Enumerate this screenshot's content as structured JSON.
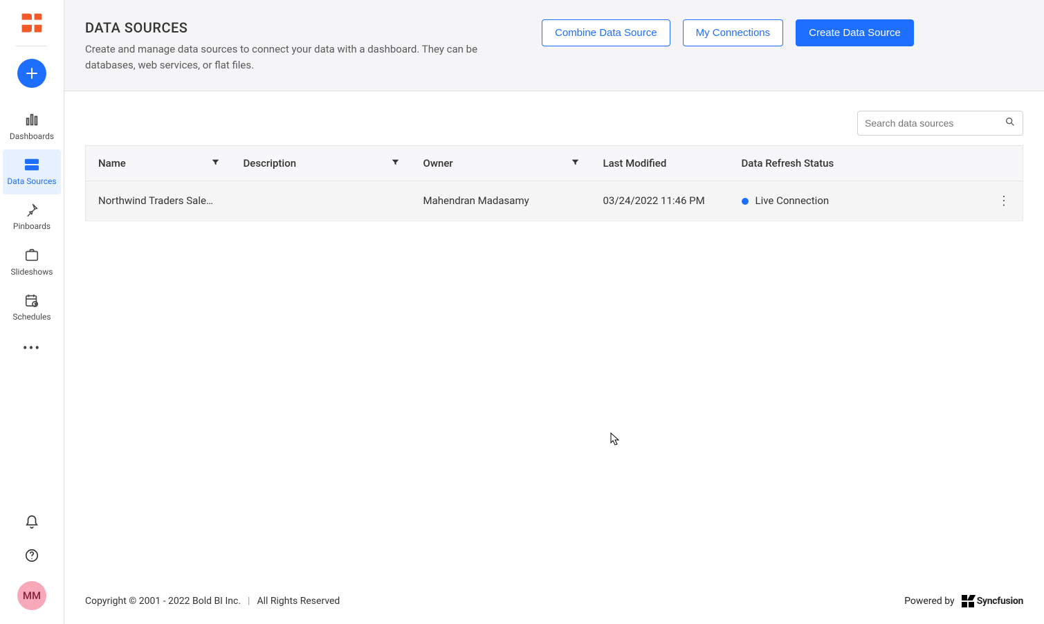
{
  "sidebar": {
    "nav": [
      {
        "label": "Dashboards",
        "iconName": "dashboards-icon"
      },
      {
        "label": "Data Sources",
        "iconName": "data-sources-icon"
      },
      {
        "label": "Pinboards",
        "iconName": "pinboards-icon"
      },
      {
        "label": "Slideshows",
        "iconName": "slideshows-icon"
      },
      {
        "label": "Schedules",
        "iconName": "schedules-icon"
      }
    ],
    "avatarInitials": "MM"
  },
  "header": {
    "title": "DATA SOURCES",
    "subtitle": "Create and manage data sources to connect your data with a dashboard. They can be databases, web services, or flat files.",
    "buttons": {
      "combine": "Combine Data Source",
      "myConnections": "My Connections",
      "create": "Create Data Source"
    }
  },
  "search": {
    "placeholder": "Search data sources"
  },
  "table": {
    "columns": {
      "name": "Name",
      "description": "Description",
      "owner": "Owner",
      "lastModified": "Last Modified",
      "refreshStatus": "Data Refresh Status"
    },
    "rows": [
      {
        "name": "Northwind Traders Sale…",
        "description": "",
        "owner": "Mahendran Madasamy",
        "lastModified": "03/24/2022 11:46 PM",
        "refreshStatus": "Live Connection"
      }
    ]
  },
  "footer": {
    "copyright": "Copyright © 2001 - 2022 Bold BI Inc.",
    "rights": "All Rights Reserved",
    "poweredBy": "Powered by",
    "brand": "Syncfusion"
  }
}
